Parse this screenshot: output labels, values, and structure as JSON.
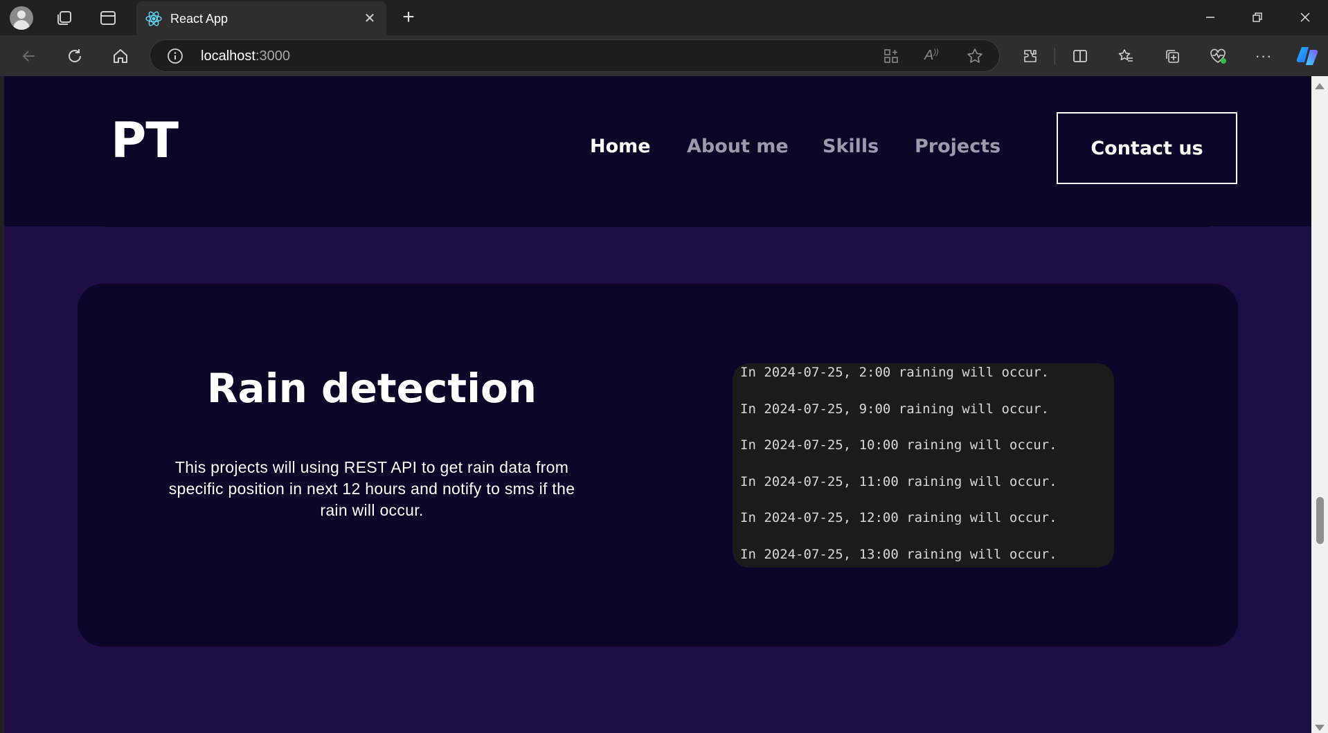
{
  "browser": {
    "tab_title": "React App",
    "url_host": "localhost",
    "url_port": ":3000"
  },
  "navbar": {
    "logo": "PT",
    "links": [
      "Home",
      "About me",
      "Skills",
      "Projects"
    ],
    "active_link": "Home",
    "contact_label": "Contact us"
  },
  "project": {
    "title": "Rain detection",
    "description": "This projects will using REST API to get rain data from specific position in next 12 hours and notify to sms if the rain will occur.",
    "log_lines": [
      "In 2024-07-25, 2:00 raining will occur.",
      "In 2024-07-25, 9:00 raining will occur.",
      "In 2024-07-25, 10:00 raining will occur.",
      "In 2024-07-25, 11:00 raining will occur.",
      "In 2024-07-25, 12:00 raining will occur.",
      "In 2024-07-25, 13:00 raining will occur."
    ]
  },
  "colors": {
    "page_bg": "#1f0d46",
    "card_bg": "#0b0627",
    "log_bg": "#1b1b1b",
    "nav_inactive": "#9e99ad"
  }
}
